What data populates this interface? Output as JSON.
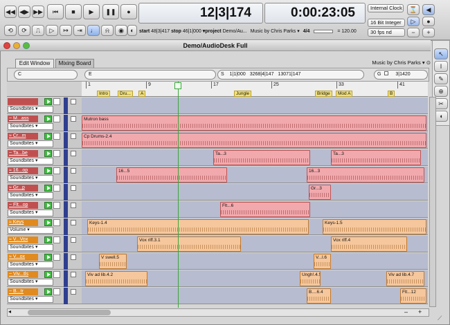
{
  "transport": {
    "bars_beats": "12|3|174",
    "clock": "0:00:23:05",
    "sync": "Internal Clock",
    "bit_depth": "16 Bit Integer",
    "frame_rate": "30 fps nd",
    "start_label": "start",
    "start_value": "48|3|417",
    "stop_label": "stop",
    "stop_value": "46|1|000",
    "project_label": "▾project",
    "project_value": "Demo/Au...",
    "artist": "Music by Chris Parks ▾",
    "time_sig": "4/4",
    "tempo": "= 120.00",
    "rewind": "◀◀",
    "back": "◀▶",
    "ffwd": "▶▶",
    "start_btn": "⏮",
    "stop_btn": "■",
    "play_btn": "▶",
    "pause_btn": "❚❚",
    "record_btn": "●"
  },
  "window": {
    "title": "Demo/AudioDesk Full"
  },
  "tabs": [
    {
      "label": "Edit Window"
    },
    {
      "label": "Mixing Board"
    }
  ],
  "info": {
    "music_by": "Music by Chris Parks ▾",
    "c_label": "C",
    "e_label": "E",
    "s_label": "S",
    "g_label": "G",
    "loc1": "1|1|000",
    "loc2": "3268|4|147",
    "loc3": "13071|147",
    "g_value": "3|1420"
  },
  "ruler": {
    "bars": [
      "1",
      "9",
      "17",
      "25",
      "33",
      "41"
    ],
    "markers": [
      "Intro",
      "Dru...",
      "A",
      "Jungle",
      "Bridge",
      "Mod A",
      "B"
    ]
  },
  "tracks": [
    {
      "name": "",
      "menu": "Soundbites",
      "color": "#c05050",
      "clips": []
    },
    {
      "name": "~ M...ass",
      "menu": "Soundbites",
      "color": "#c05050",
      "clips": [
        {
          "label": "Mutron bass",
          "style": "r",
          "from": 0,
          "to": 498
        }
      ]
    },
    {
      "name": "≈ Cr...m",
      "menu": "Soundbites",
      "color": "#c05050",
      "clips": [
        {
          "label": "Cp Drums-2.4",
          "style": "r",
          "from": 0,
          "to": 498
        }
      ]
    },
    {
      "name": "~ Ta...be",
      "menu": "Soundbites",
      "color": "#c05050",
      "clips": [
        {
          "label": "Ta...3",
          "style": "r",
          "from": 190,
          "to": 330
        },
        {
          "label": "Ta...3",
          "style": "r",
          "from": 360,
          "to": 490
        }
      ]
    },
    {
      "name": "≈ 16...op",
      "menu": "Soundbites",
      "color": "#c05050",
      "clips": [
        {
          "label": "16...5",
          "style": "r",
          "from": 50,
          "to": 210
        },
        {
          "label": "16...3",
          "style": "r",
          "from": 325,
          "to": 495
        }
      ]
    },
    {
      "name": "≈ Gr...p",
      "menu": "Soundbites",
      "color": "#c05050",
      "clips": [
        {
          "label": "Gr...3",
          "style": "r",
          "from": 328,
          "to": 360
        }
      ]
    },
    {
      "name": "~ Flt...op",
      "menu": "Soundbites",
      "color": "#c05050",
      "clips": [
        {
          "label": "Flt...6",
          "style": "r",
          "from": 200,
          "to": 330
        }
      ]
    },
    {
      "name": "≈ Keys",
      "menu": "Volume",
      "color": "#e08a20",
      "clips": [
        {
          "label": "Keys-1.4",
          "style": "o",
          "from": 8,
          "to": 328
        },
        {
          "label": "Keys-1.5",
          "style": "o",
          "from": 348,
          "to": 498
        }
      ]
    },
    {
      "name": "≈ V...Vox",
      "menu": "Soundbites",
      "color": "#e08a20",
      "clips": [
        {
          "label": "Vox riff.3.1",
          "style": "o",
          "from": 80,
          "to": 230
        },
        {
          "label": "Vox riff.4",
          "style": "o",
          "from": 360,
          "to": 470
        }
      ]
    },
    {
      "name": "≈ V...ox",
      "menu": "Soundbites",
      "color": "#e08a20",
      "clips": [
        {
          "label": "V swell.5",
          "style": "o",
          "from": 25,
          "to": 65
        },
        {
          "label": "V...l.6",
          "style": "o",
          "from": 335,
          "to": 360
        }
      ]
    },
    {
      "name": "~ Viv...tls",
      "menu": "Soundbites",
      "color": "#e08a20",
      "clips": [
        {
          "label": "Viv ad lib.4.2",
          "style": "o",
          "from": 5,
          "to": 95
        },
        {
          "label": "Ungh!.4.5",
          "style": "o",
          "from": 315,
          "to": 345
        },
        {
          "label": "Viv ad lib.4.7",
          "style": "o",
          "from": 440,
          "to": 495
        }
      ]
    },
    {
      "name": "~ B...tr",
      "menu": "Soundbites",
      "color": "#e08a20",
      "clips": [
        {
          "label": "B....6.4",
          "style": "o",
          "from": 325,
          "to": 360
        },
        {
          "label": "Flt...12",
          "style": "o",
          "from": 460,
          "to": 498
        }
      ]
    }
  ]
}
